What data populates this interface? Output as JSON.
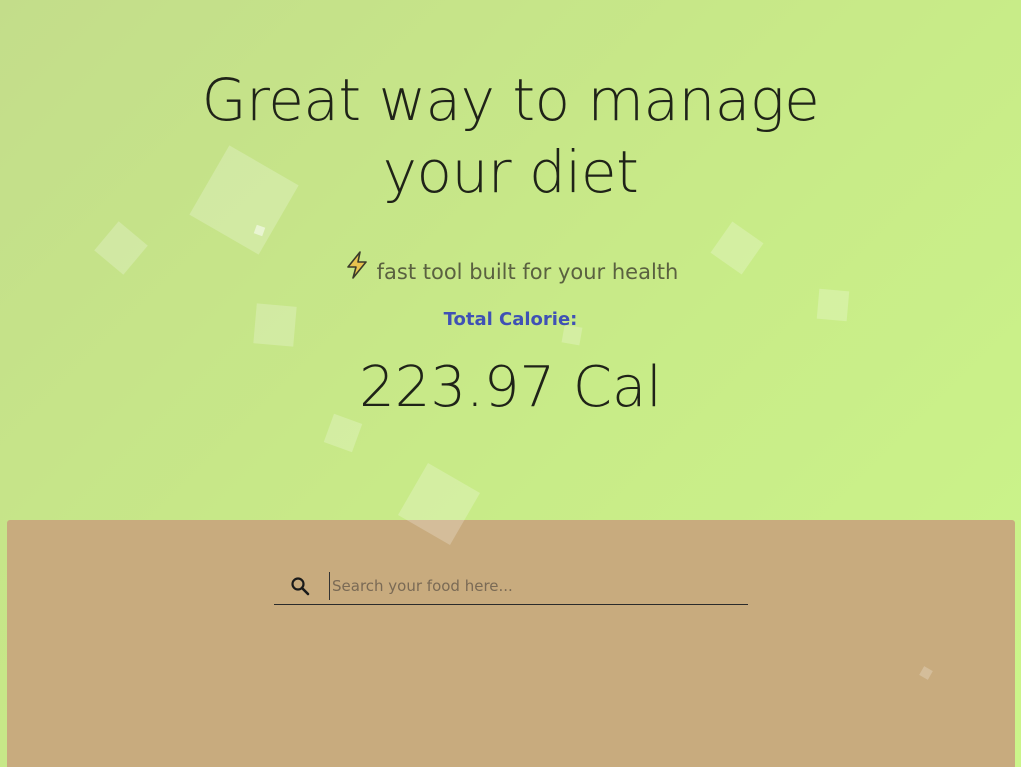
{
  "hero": {
    "title_line1": "Great way to manage",
    "title_line2": "your diet",
    "tagline": "fast tool built for your health",
    "tagline_icon": "lightning-bolt-icon"
  },
  "calorie": {
    "label": "Total Calorie:",
    "value": "223.97 Cal"
  },
  "search": {
    "placeholder": "Search your food here...",
    "value": "",
    "icon": "search-icon"
  },
  "colors": {
    "background_start": "#c3dd8a",
    "background_end": "#cbf58a",
    "panel": "#c8ab7e",
    "accent_label": "#3f51b5",
    "text_dark": "#1f2318"
  }
}
